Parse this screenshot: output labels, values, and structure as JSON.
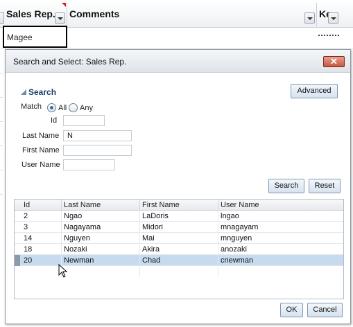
{
  "grid": {
    "headers": {
      "sales_rep": "Sales Rep.",
      "comments": "Comments",
      "key": "Ke"
    },
    "selected_cell": "Magee"
  },
  "dialog": {
    "title": "Search and Select: Sales Rep.",
    "close_icon": "close-x-icon",
    "search": {
      "heading": "Search",
      "advanced_label": "Advanced",
      "match_label": "Match",
      "match_options": [
        "All",
        "Any"
      ],
      "match_selected": "All",
      "fields": {
        "id": {
          "label": "Id",
          "value": ""
        },
        "last_name": {
          "label": "Last Name",
          "value": "N"
        },
        "first_name": {
          "label": "First Name",
          "value": ""
        },
        "user_name": {
          "label": "User Name",
          "value": ""
        }
      },
      "search_button": "Search",
      "reset_button": "Reset"
    },
    "results": {
      "columns": [
        "Id",
        "Last Name",
        "First Name",
        "User Name"
      ],
      "rows": [
        {
          "id": "2",
          "last_name": "Ngao",
          "first_name": "LaDoris",
          "user_name": "lngao"
        },
        {
          "id": "3",
          "last_name": "Nagayama",
          "first_name": "Midori",
          "user_name": "mnagayam"
        },
        {
          "id": "14",
          "last_name": "Nguyen",
          "first_name": "Mai",
          "user_name": "mnguyen"
        },
        {
          "id": "18",
          "last_name": "Nozaki",
          "first_name": "Akira",
          "user_name": "anozaki"
        },
        {
          "id": "20",
          "last_name": "Newman",
          "first_name": "Chad",
          "user_name": "cnewman"
        }
      ],
      "selected_row_index": 4
    },
    "ok_button": "OK",
    "cancel_button": "Cancel"
  },
  "colors": {
    "accent": "#2d6db3",
    "selected_row": "#c7dbf0",
    "close_button": "#c8553f"
  }
}
